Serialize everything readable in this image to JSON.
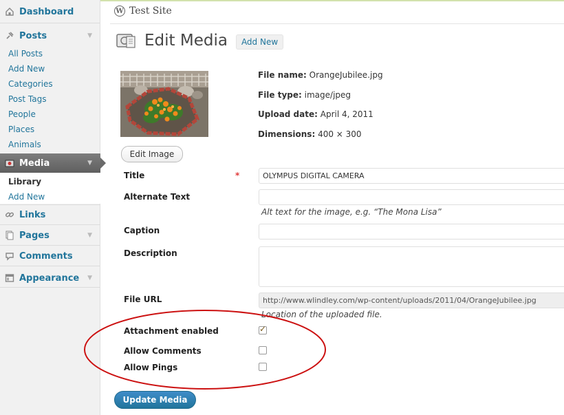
{
  "header": {
    "site_name": "Test Site",
    "page_title": "Edit Media",
    "add_new_label": "Add New"
  },
  "sidebar": {
    "dashboard": "Dashboard",
    "posts": {
      "label": "Posts",
      "items": [
        "All Posts",
        "Add New",
        "Categories",
        "Post Tags",
        "People",
        "Places",
        "Animals"
      ]
    },
    "media": {
      "label": "Media",
      "items": [
        "Library",
        "Add New"
      ]
    },
    "links": "Links",
    "pages": "Pages",
    "comments": "Comments",
    "appearance": "Appearance"
  },
  "file_info": {
    "name_label": "File name:",
    "name": "OrangeJubilee.jpg",
    "type_label": "File type:",
    "type": "image/jpeg",
    "date_label": "Upload date:",
    "date": "April 4, 2011",
    "dims_label": "Dimensions:",
    "dims": "400 × 300"
  },
  "edit_image_label": "Edit Image",
  "form": {
    "title_label": "Title",
    "required_mark": "*",
    "title_value": "OLYMPUS DIGITAL CAMERA",
    "alt_label": "Alternate Text",
    "alt_value": "",
    "alt_hint": "Alt text for the image, e.g. “The Mona Lisa”",
    "caption_label": "Caption",
    "caption_value": "",
    "description_label": "Description",
    "description_value": "",
    "url_label": "File URL",
    "url_value": "http://www.wlindley.com/wp-content/uploads/2011/04/OrangeJubilee.jpg",
    "url_hint": "Location of the uploaded file.",
    "attachment_label": "Attachment enabled",
    "attachment_checked": true,
    "comments_label": "Allow Comments",
    "comments_checked": false,
    "pings_label": "Allow Pings",
    "pings_checked": false
  },
  "update_label": "Update Media",
  "colors": {
    "link": "#21759b",
    "oval": "#cc1111",
    "primary_button": "#21759b"
  },
  "icons": [
    "dashboard-icon",
    "posts-pin-icon",
    "media-icon",
    "links-icon",
    "pages-icon",
    "comments-icon",
    "appearance-icon",
    "wordpress-logo-icon"
  ]
}
